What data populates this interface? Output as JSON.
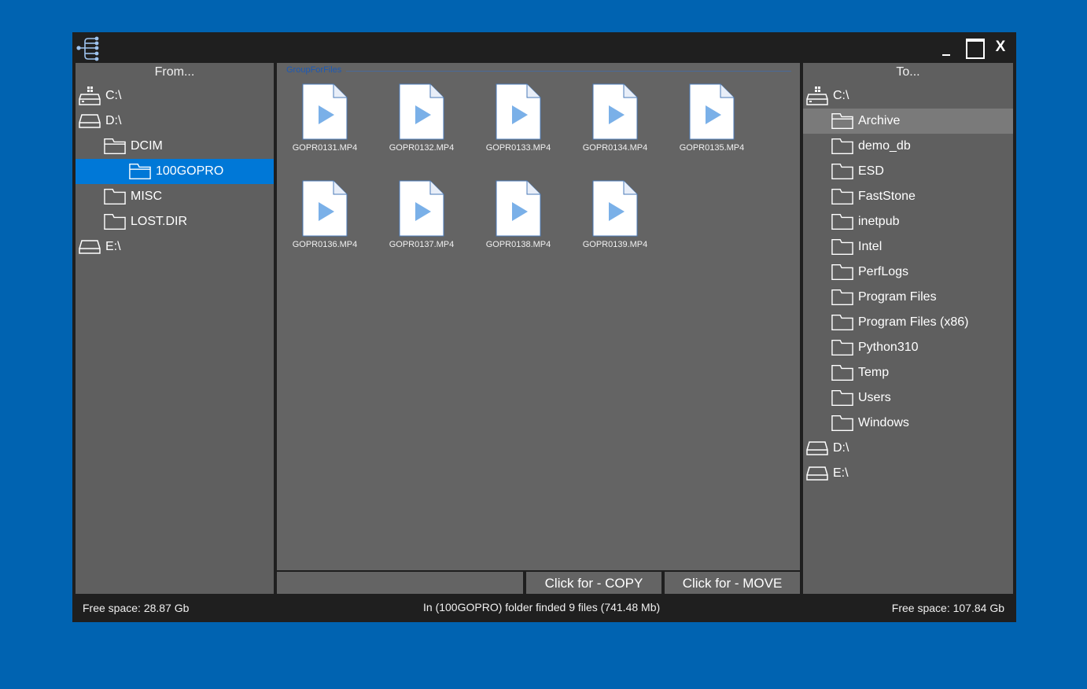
{
  "title_bar": {
    "minimize_label": "_",
    "close_label": "X"
  },
  "left_panel": {
    "header": "From...",
    "items": [
      {
        "label": "C:\\",
        "icon": "windows-drive-icon",
        "level": 0
      },
      {
        "label": "D:\\",
        "icon": "drive-icon",
        "level": 0
      },
      {
        "label": "DCIM",
        "icon": "folder-open-icon",
        "level": 1
      },
      {
        "label": "100GOPRO",
        "icon": "folder-open-icon",
        "level": 2,
        "selected": true
      },
      {
        "label": "MISC",
        "icon": "folder-icon",
        "level": 1
      },
      {
        "label": "LOST.DIR",
        "icon": "folder-icon",
        "level": 1
      },
      {
        "label": "E:\\",
        "icon": "drive-icon",
        "level": 0
      }
    ],
    "free_space": "Free space: 28.87 Gb"
  },
  "center": {
    "group_label": "GroupForFiles",
    "files": [
      "GOPR0131.MP4",
      "GOPR0132.MP4",
      "GOPR0133.MP4",
      "GOPR0134.MP4",
      "GOPR0135.MP4",
      "GOPR0136.MP4",
      "GOPR0137.MP4",
      "GOPR0138.MP4",
      "GOPR0139.MP4"
    ],
    "file_icon": "video-file-icon",
    "copy_button": "Click for - COPY",
    "move_button": "Click for - MOVE",
    "status": "In (100GOPRO) folder finded 9 files (741.48 Mb)"
  },
  "right_panel": {
    "header": "To...",
    "items": [
      {
        "label": "C:\\",
        "icon": "windows-drive-icon",
        "level": 0
      },
      {
        "label": "Archive",
        "icon": "folder-open-icon",
        "level": 1,
        "highlighted": true
      },
      {
        "label": "demo_db",
        "icon": "folder-icon",
        "level": 1
      },
      {
        "label": "ESD",
        "icon": "folder-icon",
        "level": 1
      },
      {
        "label": "FastStone",
        "icon": "folder-icon",
        "level": 1
      },
      {
        "label": "inetpub",
        "icon": "folder-icon",
        "level": 1
      },
      {
        "label": "Intel",
        "icon": "folder-icon",
        "level": 1
      },
      {
        "label": "PerfLogs",
        "icon": "folder-icon",
        "level": 1
      },
      {
        "label": "Program Files",
        "icon": "folder-icon",
        "level": 1
      },
      {
        "label": "Program Files (x86)",
        "icon": "folder-icon",
        "level": 1
      },
      {
        "label": "Python310",
        "icon": "folder-icon",
        "level": 1
      },
      {
        "label": "Temp",
        "icon": "folder-icon",
        "level": 1
      },
      {
        "label": "Users",
        "icon": "folder-icon",
        "level": 1
      },
      {
        "label": "Windows",
        "icon": "folder-icon",
        "level": 1
      },
      {
        "label": "D:\\",
        "icon": "drive-icon",
        "level": 0
      },
      {
        "label": "E:\\",
        "icon": "drive-icon",
        "level": 0
      }
    ],
    "free_space": "Free space: 107.84 Gb"
  },
  "colors": {
    "desktop": "#0063b1",
    "window": "#1f1f1f",
    "panel": "#5f5f5f",
    "selected": "#0078d7",
    "play_icon": "#7ab0e8"
  }
}
